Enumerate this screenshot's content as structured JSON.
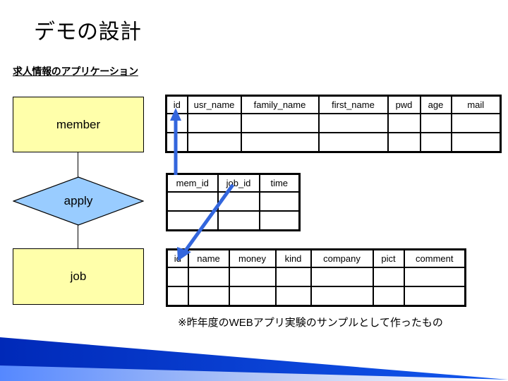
{
  "slide": {
    "title": "デモの設計",
    "subtitle": "求人情報のアプリケーション",
    "caption": "※昨年度のWEBアプリ実験のサンプルとして作ったもの"
  },
  "colors": {
    "entity_fill": "#FFFFAA",
    "relationship_fill": "#99CCFF",
    "arrow": "#3366DD",
    "outline": "#000000",
    "footer_dark": "#0033CC",
    "footer_light": "#6699FF"
  },
  "er_diagram": {
    "entities": [
      {
        "id": "member",
        "label": "member",
        "shape": "rectangle"
      },
      {
        "id": "job",
        "label": "job",
        "shape": "rectangle"
      }
    ],
    "relationships": [
      {
        "id": "apply",
        "label": "apply",
        "shape": "diamond"
      }
    ],
    "connectors": [
      {
        "from": "member",
        "to": "apply"
      },
      {
        "from": "apply",
        "to": "job"
      }
    ]
  },
  "tables": {
    "member": {
      "name": "member",
      "columns": [
        "id",
        "usr_name",
        "family_name",
        "first_name",
        "pwd",
        "age",
        "mail"
      ],
      "rows": [
        [
          "",
          "",
          "",
          "",
          "",
          "",
          ""
        ],
        [
          "",
          "",
          "",
          "",
          "",
          "",
          ""
        ]
      ]
    },
    "apply": {
      "name": "apply",
      "columns": [
        "mem_id",
        "job_id",
        "time"
      ],
      "rows": [
        [
          "",
          "",
          ""
        ],
        [
          "",
          "",
          ""
        ]
      ]
    },
    "job": {
      "name": "job",
      "columns": [
        "id",
        "name",
        "money",
        "kind",
        "company",
        "pict",
        "comment"
      ],
      "rows": [
        [
          "",
          "",
          "",
          "",
          "",
          "",
          ""
        ],
        [
          "",
          "",
          "",
          "",
          "",
          "",
          ""
        ]
      ]
    }
  },
  "foreign_key_arrows": [
    {
      "id": "mem-id-to-member-id",
      "from": "apply.mem_id",
      "to": "member.id",
      "direction": "up"
    },
    {
      "id": "job-id-to-job-id",
      "from": "apply.job_id",
      "to": "job.id",
      "direction": "down-left"
    }
  ]
}
